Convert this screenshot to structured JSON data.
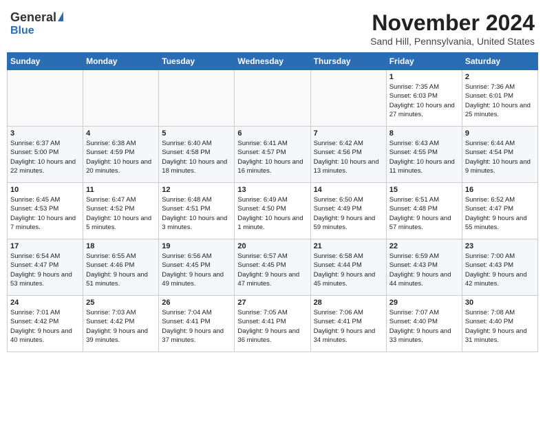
{
  "header": {
    "logo_general": "General",
    "logo_blue": "Blue",
    "title": "November 2024",
    "subtitle": "Sand Hill, Pennsylvania, United States"
  },
  "days_of_week": [
    "Sunday",
    "Monday",
    "Tuesday",
    "Wednesday",
    "Thursday",
    "Friday",
    "Saturday"
  ],
  "weeks": [
    [
      {
        "day": "",
        "info": ""
      },
      {
        "day": "",
        "info": ""
      },
      {
        "day": "",
        "info": ""
      },
      {
        "day": "",
        "info": ""
      },
      {
        "day": "",
        "info": ""
      },
      {
        "day": "1",
        "info": "Sunrise: 7:35 AM\nSunset: 6:03 PM\nDaylight: 10 hours and 27 minutes."
      },
      {
        "day": "2",
        "info": "Sunrise: 7:36 AM\nSunset: 6:01 PM\nDaylight: 10 hours and 25 minutes."
      }
    ],
    [
      {
        "day": "3",
        "info": "Sunrise: 6:37 AM\nSunset: 5:00 PM\nDaylight: 10 hours and 22 minutes."
      },
      {
        "day": "4",
        "info": "Sunrise: 6:38 AM\nSunset: 4:59 PM\nDaylight: 10 hours and 20 minutes."
      },
      {
        "day": "5",
        "info": "Sunrise: 6:40 AM\nSunset: 4:58 PM\nDaylight: 10 hours and 18 minutes."
      },
      {
        "day": "6",
        "info": "Sunrise: 6:41 AM\nSunset: 4:57 PM\nDaylight: 10 hours and 16 minutes."
      },
      {
        "day": "7",
        "info": "Sunrise: 6:42 AM\nSunset: 4:56 PM\nDaylight: 10 hours and 13 minutes."
      },
      {
        "day": "8",
        "info": "Sunrise: 6:43 AM\nSunset: 4:55 PM\nDaylight: 10 hours and 11 minutes."
      },
      {
        "day": "9",
        "info": "Sunrise: 6:44 AM\nSunset: 4:54 PM\nDaylight: 10 hours and 9 minutes."
      }
    ],
    [
      {
        "day": "10",
        "info": "Sunrise: 6:45 AM\nSunset: 4:53 PM\nDaylight: 10 hours and 7 minutes."
      },
      {
        "day": "11",
        "info": "Sunrise: 6:47 AM\nSunset: 4:52 PM\nDaylight: 10 hours and 5 minutes."
      },
      {
        "day": "12",
        "info": "Sunrise: 6:48 AM\nSunset: 4:51 PM\nDaylight: 10 hours and 3 minutes."
      },
      {
        "day": "13",
        "info": "Sunrise: 6:49 AM\nSunset: 4:50 PM\nDaylight: 10 hours and 1 minute."
      },
      {
        "day": "14",
        "info": "Sunrise: 6:50 AM\nSunset: 4:49 PM\nDaylight: 9 hours and 59 minutes."
      },
      {
        "day": "15",
        "info": "Sunrise: 6:51 AM\nSunset: 4:48 PM\nDaylight: 9 hours and 57 minutes."
      },
      {
        "day": "16",
        "info": "Sunrise: 6:52 AM\nSunset: 4:47 PM\nDaylight: 9 hours and 55 minutes."
      }
    ],
    [
      {
        "day": "17",
        "info": "Sunrise: 6:54 AM\nSunset: 4:47 PM\nDaylight: 9 hours and 53 minutes."
      },
      {
        "day": "18",
        "info": "Sunrise: 6:55 AM\nSunset: 4:46 PM\nDaylight: 9 hours and 51 minutes."
      },
      {
        "day": "19",
        "info": "Sunrise: 6:56 AM\nSunset: 4:45 PM\nDaylight: 9 hours and 49 minutes."
      },
      {
        "day": "20",
        "info": "Sunrise: 6:57 AM\nSunset: 4:45 PM\nDaylight: 9 hours and 47 minutes."
      },
      {
        "day": "21",
        "info": "Sunrise: 6:58 AM\nSunset: 4:44 PM\nDaylight: 9 hours and 45 minutes."
      },
      {
        "day": "22",
        "info": "Sunrise: 6:59 AM\nSunset: 4:43 PM\nDaylight: 9 hours and 44 minutes."
      },
      {
        "day": "23",
        "info": "Sunrise: 7:00 AM\nSunset: 4:43 PM\nDaylight: 9 hours and 42 minutes."
      }
    ],
    [
      {
        "day": "24",
        "info": "Sunrise: 7:01 AM\nSunset: 4:42 PM\nDaylight: 9 hours and 40 minutes."
      },
      {
        "day": "25",
        "info": "Sunrise: 7:03 AM\nSunset: 4:42 PM\nDaylight: 9 hours and 39 minutes."
      },
      {
        "day": "26",
        "info": "Sunrise: 7:04 AM\nSunset: 4:41 PM\nDaylight: 9 hours and 37 minutes."
      },
      {
        "day": "27",
        "info": "Sunrise: 7:05 AM\nSunset: 4:41 PM\nDaylight: 9 hours and 36 minutes."
      },
      {
        "day": "28",
        "info": "Sunrise: 7:06 AM\nSunset: 4:41 PM\nDaylight: 9 hours and 34 minutes."
      },
      {
        "day": "29",
        "info": "Sunrise: 7:07 AM\nSunset: 4:40 PM\nDaylight: 9 hours and 33 minutes."
      },
      {
        "day": "30",
        "info": "Sunrise: 7:08 AM\nSunset: 4:40 PM\nDaylight: 9 hours and 31 minutes."
      }
    ]
  ]
}
